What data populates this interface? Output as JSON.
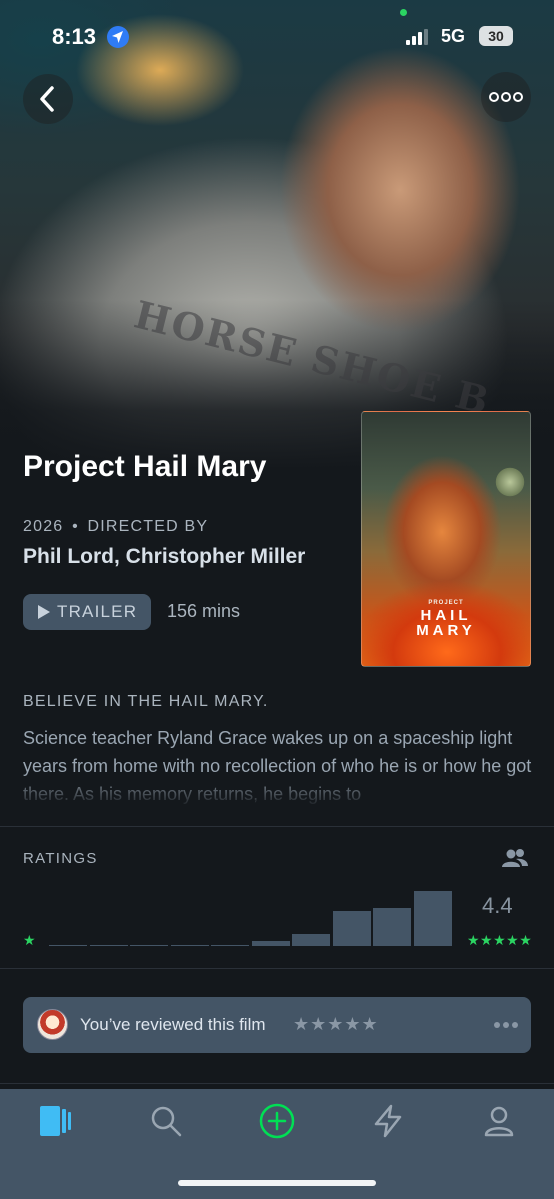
{
  "status_bar": {
    "time": "8:13",
    "network": "5G",
    "battery": "30"
  },
  "film": {
    "title": "Project Hail Mary",
    "year": "2026",
    "directed_by_label": "DIRECTED BY",
    "directors": "Phil Lord, Christopher Miller",
    "trailer_label": "TRAILER",
    "runtime": "156 mins",
    "hero_shirt_text": "HORSE SHOE B",
    "poster": {
      "small_text": "PROJECT",
      "title_line1": "HAIL",
      "title_line2": "MARY"
    }
  },
  "synopsis": {
    "tagline": "BELIEVE IN THE HAIL MARY.",
    "text": "Science teacher Ryland Grace wakes up on a spaceship light years from home with no recollection of who he is or how he got there. As his memory returns, he begins to"
  },
  "ratings": {
    "label": "RATINGS",
    "average": "4.4",
    "min_star": "★",
    "max_stars": "★★★★★",
    "histogram": [
      0.02,
      0.02,
      0.02,
      0.02,
      0.02,
      0.08,
      0.2,
      0.6,
      0.65,
      0.95
    ]
  },
  "review": {
    "text": "You’ve reviewed this film",
    "stars": "★★★★★"
  },
  "tab_bar": {
    "items": [
      "films-icon",
      "search-icon",
      "add-icon",
      "activity-icon",
      "profile-icon"
    ],
    "active_color": "#40bcf4",
    "add_color": "#00e054"
  },
  "colors": {
    "background": "#14181c",
    "accent_green": "#2bd462",
    "panel": "#445566"
  }
}
